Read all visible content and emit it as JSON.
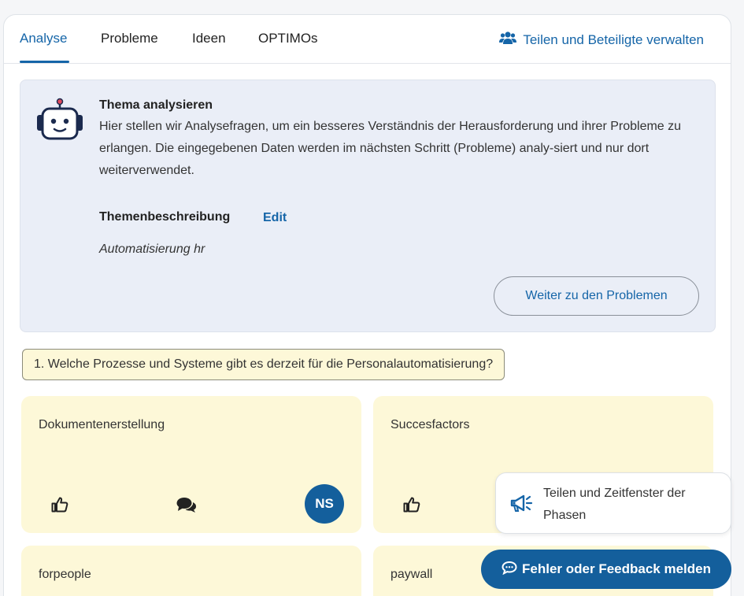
{
  "tabs": [
    {
      "label": "Analyse",
      "active": true
    },
    {
      "label": "Probleme",
      "active": false
    },
    {
      "label": "Ideen",
      "active": false
    },
    {
      "label": "OPTIMOs",
      "active": false
    }
  ],
  "share_link": {
    "label": "Teilen und Beteiligte verwalten",
    "icon": "users-icon"
  },
  "info": {
    "icon": "robot-icon",
    "title": "Thema analysieren",
    "text": "Hier stellen wir Analysefragen, um ein besseres Verständnis der Herausforderung und ihrer Probleme zu erlangen.  Die eingegebenen Daten werden im nächsten Schritt (Probleme) analy-siert und nur dort weiterverwendet.",
    "description_label": "Themenbeschreibung",
    "edit_label": "Edit",
    "description_value": "Automatisierung hr",
    "next_button": "Weiter zu den Problemen"
  },
  "question": "1. Welche Prozesse und Systeme gibt es derzeit für die Personalautomatisierung?",
  "cards": [
    {
      "text": "Dokumentenerstellung",
      "avatar": "NS"
    },
    {
      "text": "Succesfactors"
    },
    {
      "text": "forpeople"
    },
    {
      "text": "paywall"
    }
  ],
  "toast": {
    "text": "Teilen und Zeitfenster der Phasen",
    "icon": "megaphone-icon"
  },
  "feedback_button": {
    "label": "Fehler oder Feedback melden",
    "icon": "chat-icon"
  },
  "colors": {
    "accent": "#1565a8",
    "card_bg": "#fdf8d8",
    "info_bg": "#eaeef7",
    "avatar_bg": "#145f9c"
  }
}
